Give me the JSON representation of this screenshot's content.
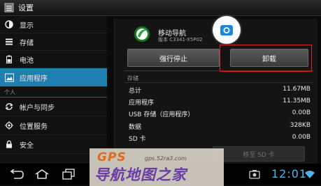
{
  "titlebar": {
    "title": "设置",
    "icon": "settings-icon"
  },
  "sidebar": {
    "items": [
      {
        "label": "显示",
        "icon": "display-icon"
      },
      {
        "label": "存储",
        "icon": "storage-icon"
      },
      {
        "label": "电池",
        "icon": "battery-icon"
      },
      {
        "label": "应用程序",
        "icon": "apps-icon",
        "selected": true
      }
    ],
    "section_personal": "个人",
    "items2": [
      {
        "label": "帐户与同步",
        "icon": "sync-icon"
      },
      {
        "label": "位置服务",
        "icon": "location-icon"
      },
      {
        "label": "安全",
        "icon": "lock-icon"
      }
    ]
  },
  "app": {
    "name": "移动导航",
    "version": "版本 C3341-X5P02"
  },
  "buttons": {
    "force_stop": "强行停止",
    "uninstall": "卸载",
    "move_sd": "移至 SD 卡"
  },
  "storage": {
    "header": "存储",
    "rows": [
      {
        "label": "总计",
        "value": "11.67MB"
      },
      {
        "label": "应用程序",
        "value": "11.35MB"
      },
      {
        "label": "USB 存储（应用程序）",
        "value": "0.00B"
      },
      {
        "label": "数据",
        "value": "328KB"
      },
      {
        "label": "SD 卡",
        "value": "0.00B"
      }
    ]
  },
  "status": {
    "time": "12:01"
  },
  "watermark": {
    "brand": "GPS",
    "url": "gps.52ra3.com",
    "name": "导航地图之家"
  },
  "colors": {
    "accent": "#1f7fb0",
    "clock": "#4fb4e8",
    "highlight": "#dd2222"
  }
}
